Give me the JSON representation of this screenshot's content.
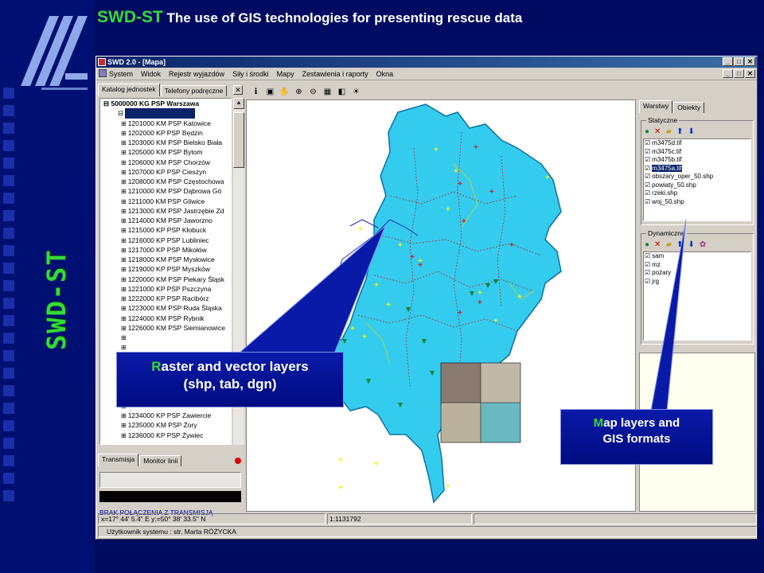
{
  "slide": {
    "title_prefix": "SWD-ST",
    "title_rest": " The use of GIS technologies for presenting rescue data",
    "side_title": "SWD-ST"
  },
  "window": {
    "title": "SWD 2.0 - [Mapa]",
    "controls": [
      "_",
      "□",
      "✕"
    ],
    "menu": [
      "System",
      "Widok",
      "Rejestr wyjazdów",
      "Siły i środki",
      "Mapy",
      "Zestawienia i raporty",
      "Okna"
    ]
  },
  "left_panel": {
    "tabs": [
      "Katalog jednostek",
      "Telefony podręczne"
    ],
    "close": "✕",
    "root": "5000000 KG PSP Warszawa",
    "units": [
      "1201000 KM PSP Katowice",
      "1202000 KP PSP Będzin",
      "1203000 KM PSP Bielsko Biała",
      "1205000 KM PSP Bytom",
      "1206000 KM PSP Chorzów",
      "1207000 KP PSP Cieszyn",
      "1208000 KM PSP Częstochowa",
      "1210000 KM PSP Dąbrowa Gó",
      "1211000 KM PSP Gliwice",
      "1213000 KM PSP Jastrzębie Zd",
      "1214000 KM PSP Jaworzno",
      "1215000 KP PSP Kłobuck",
      "1216000 KP PSP Lubliniec",
      "1217000 KP PSP Mikołów",
      "1218000 KM PSP Mysłowice",
      "1219000 KP PSP Myszków",
      "1220000 KM PSP Piekary Śląsk",
      "1221000 KP PSP Pszczyna",
      "1222000 KP PSP Racibórz",
      "1223000 KM PSP Ruda Śląska",
      "1224000 KM PSP Rybnik",
      "1226000 KM PSP Siemianowice",
      "",
      "",
      "",
      "",
      "",
      "",
      "",
      "",
      "1234000 KP PSP Zawiercie",
      "1235000 KM PSP Żory",
      "1236000 KP PSP Żywiec"
    ]
  },
  "bottom_panel": {
    "tabs": [
      "Transmisja",
      "Monitor linii"
    ],
    "status_text": "BRAK POŁĄCZENIA Z TRANSMISJĄ"
  },
  "right_panel": {
    "tabs": [
      "Warstwy",
      "Obiekty"
    ],
    "static_label": "Statyczne",
    "static_layers": [
      "m3475d.tif",
      "m3475c.tif",
      "m3475b.tif",
      "m3475a.tif",
      "obszary_oper_50.shp",
      "powiaty_50.shp",
      "rzeki.shp",
      "woj_50.shp"
    ],
    "static_selected_index": 3,
    "dynamic_label": "Dynamiczne",
    "dynamic_layers": [
      "sam",
      "mz",
      "pożary",
      "jrg"
    ]
  },
  "statusbar": {
    "coords": "x=17° 44' 5.4\" E y:=50° 38' 33.5\" N",
    "scale": "1:1131792",
    "user": "Użytkownik systemu : str. Marta RÓŻYCKA"
  },
  "callouts": {
    "raster": {
      "first": "R",
      "rest": "aster and vector layers",
      "line2": "(shp, tab, dgn)"
    },
    "map": {
      "first": "M",
      "rest": "ap layers and",
      "line2": "GIS formats"
    }
  },
  "colors": {
    "slide_bg": "#000e6e",
    "accent_green": "#33dd33",
    "map_fill": "#33ccee",
    "selection": "#0a246a"
  }
}
